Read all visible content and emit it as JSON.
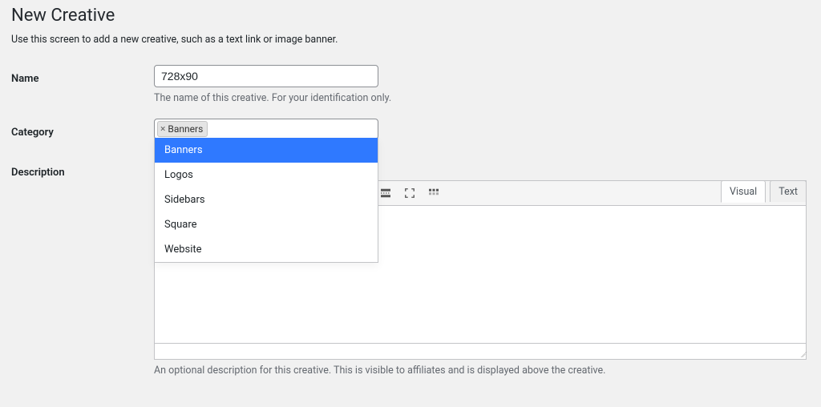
{
  "page": {
    "title": "New Creative",
    "screen_note": "Use this screen to add a new creative, such as a text link or image banner."
  },
  "name_field": {
    "label": "Name",
    "value": "728x90",
    "helper": "The name of this creative. For your identification only."
  },
  "category_field": {
    "label": "Category",
    "selected_token": "Banners",
    "options": [
      "Banners",
      "Logos",
      "Sidebars",
      "Square",
      "Website"
    ],
    "highlight_index": 0
  },
  "description_field": {
    "label": "Description",
    "tabs": {
      "visual": "Visual",
      "text": "Text",
      "active": "visual"
    },
    "helper": "An optional description for this creative. This is visible to affiliates and is displayed above the creative."
  },
  "toolbar": {
    "buttons": [
      {
        "name": "bold-icon"
      },
      {
        "name": "italic-icon"
      },
      {
        "name": "bullet-list-icon"
      },
      {
        "name": "numbered-list-icon"
      },
      {
        "name": "blockquote-icon"
      },
      {
        "name": "align-left-icon"
      },
      {
        "name": "align-center-icon"
      },
      {
        "name": "align-right-icon"
      },
      {
        "name": "link-icon"
      },
      {
        "name": "insert-more-icon"
      },
      {
        "name": "fullscreen-icon"
      },
      {
        "name": "toolbar-toggle-icon"
      }
    ]
  }
}
